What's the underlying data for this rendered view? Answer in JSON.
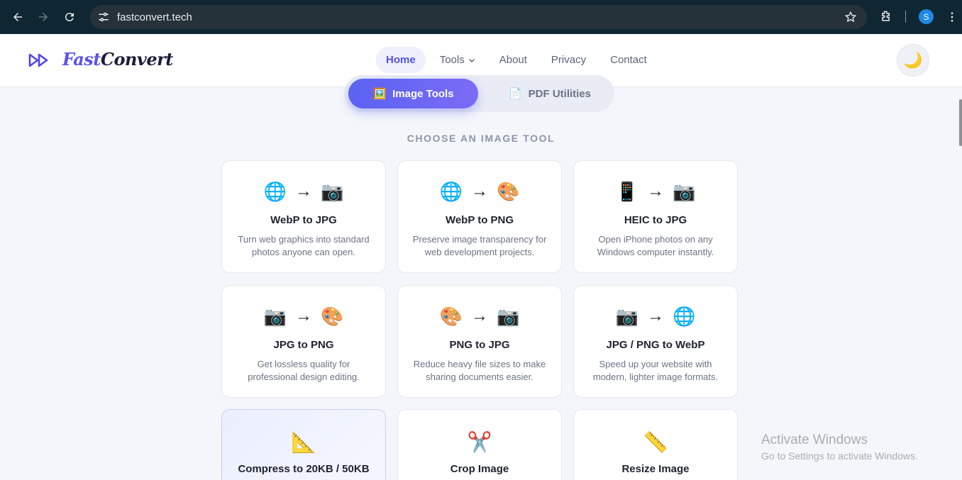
{
  "browser": {
    "url": "fastconvert.tech",
    "profile_initial": "S"
  },
  "header": {
    "logo_part1": "Fast",
    "logo_part2": "Convert",
    "nav": [
      {
        "label": "Home"
      },
      {
        "label": "Tools"
      },
      {
        "label": "About"
      },
      {
        "label": "Privacy"
      },
      {
        "label": "Contact"
      }
    ],
    "theme_icon": "🌙"
  },
  "tabs": [
    {
      "label": "Image Tools",
      "icon": "🖼️"
    },
    {
      "label": "PDF Utilities",
      "icon": "📄"
    }
  ],
  "section_label": "CHOOSE AN IMAGE TOOL",
  "cards": [
    {
      "from": "🌐",
      "to": "📷",
      "title": "WebP to JPG",
      "desc": "Turn web graphics into standard photos anyone can open."
    },
    {
      "from": "🌐",
      "to": "🎨",
      "title": "WebP to PNG",
      "desc": "Preserve image transparency for web development projects."
    },
    {
      "from": "📱",
      "to": "📷",
      "title": "HEIC to JPG",
      "desc": "Open iPhone photos on any Windows computer instantly."
    },
    {
      "from": "📷",
      "to": "🎨",
      "title": "JPG to PNG",
      "desc": "Get lossless quality for professional design editing."
    },
    {
      "from": "🎨",
      "to": "📷",
      "title": "PNG to JPG",
      "desc": "Reduce heavy file sizes to make sharing documents easier."
    },
    {
      "from": "📷",
      "to": "🌐",
      "title": "JPG / PNG to WebP",
      "desc": "Speed up your website with modern, lighter image formats."
    },
    {
      "icon": "📐",
      "title": "Compress to 20KB / 50KB"
    },
    {
      "icon": "✂️",
      "title": "Crop Image"
    },
    {
      "icon": "📏",
      "title": "Resize Image"
    }
  ],
  "arrow": "→",
  "watermark": {
    "line1": "Activate Windows",
    "line2": "Go to Settings to activate Windows."
  }
}
